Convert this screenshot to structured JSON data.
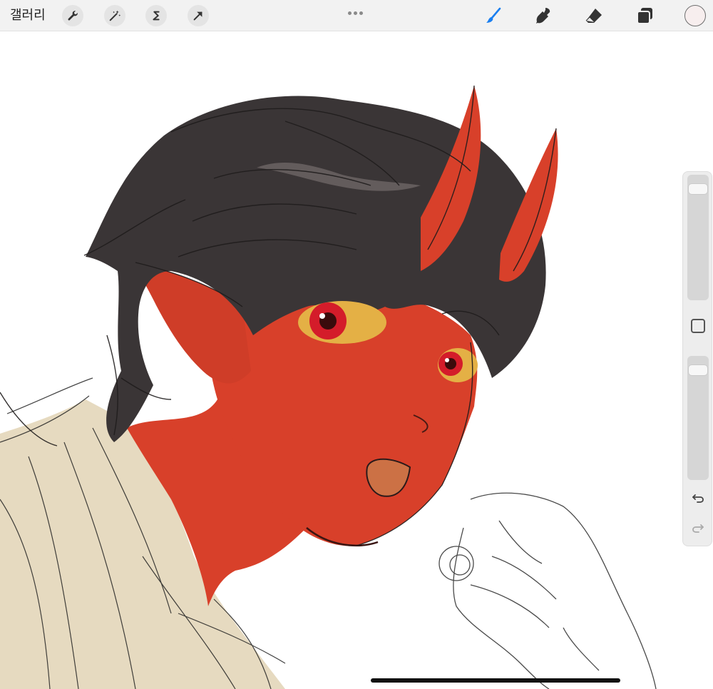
{
  "toolbar": {
    "gallery_label": "갤러리",
    "left_tools": [
      {
        "name": "actions",
        "icon": "wrench-icon"
      },
      {
        "name": "adjustments",
        "icon": "magic-wand-icon"
      },
      {
        "name": "selection",
        "icon": "selection-s-icon"
      },
      {
        "name": "transform",
        "icon": "arrow-cursor-icon"
      }
    ],
    "right_tools": [
      {
        "name": "brush",
        "icon": "brush-icon",
        "active": true
      },
      {
        "name": "smudge",
        "icon": "smudge-icon",
        "active": false
      },
      {
        "name": "eraser",
        "icon": "eraser-icon",
        "active": false
      },
      {
        "name": "layers",
        "icon": "layers-icon",
        "active": false
      }
    ],
    "current_color": "#f7eeee",
    "active_tool_color": "#1a7ff0"
  },
  "sidebar": {
    "brush_size_level": 0.93,
    "opacity_level": 0.93,
    "modify_icon": "square-icon",
    "undo_icon": "undo-arrow-icon",
    "redo_icon": "redo-arrow-icon"
  },
  "artwork": {
    "skin_color": "#d8402a",
    "hair_color": "#3a3536",
    "shirt_color": "#e6dac0",
    "eye_color": "#e4b045",
    "iris_color": "#d41c2a"
  }
}
